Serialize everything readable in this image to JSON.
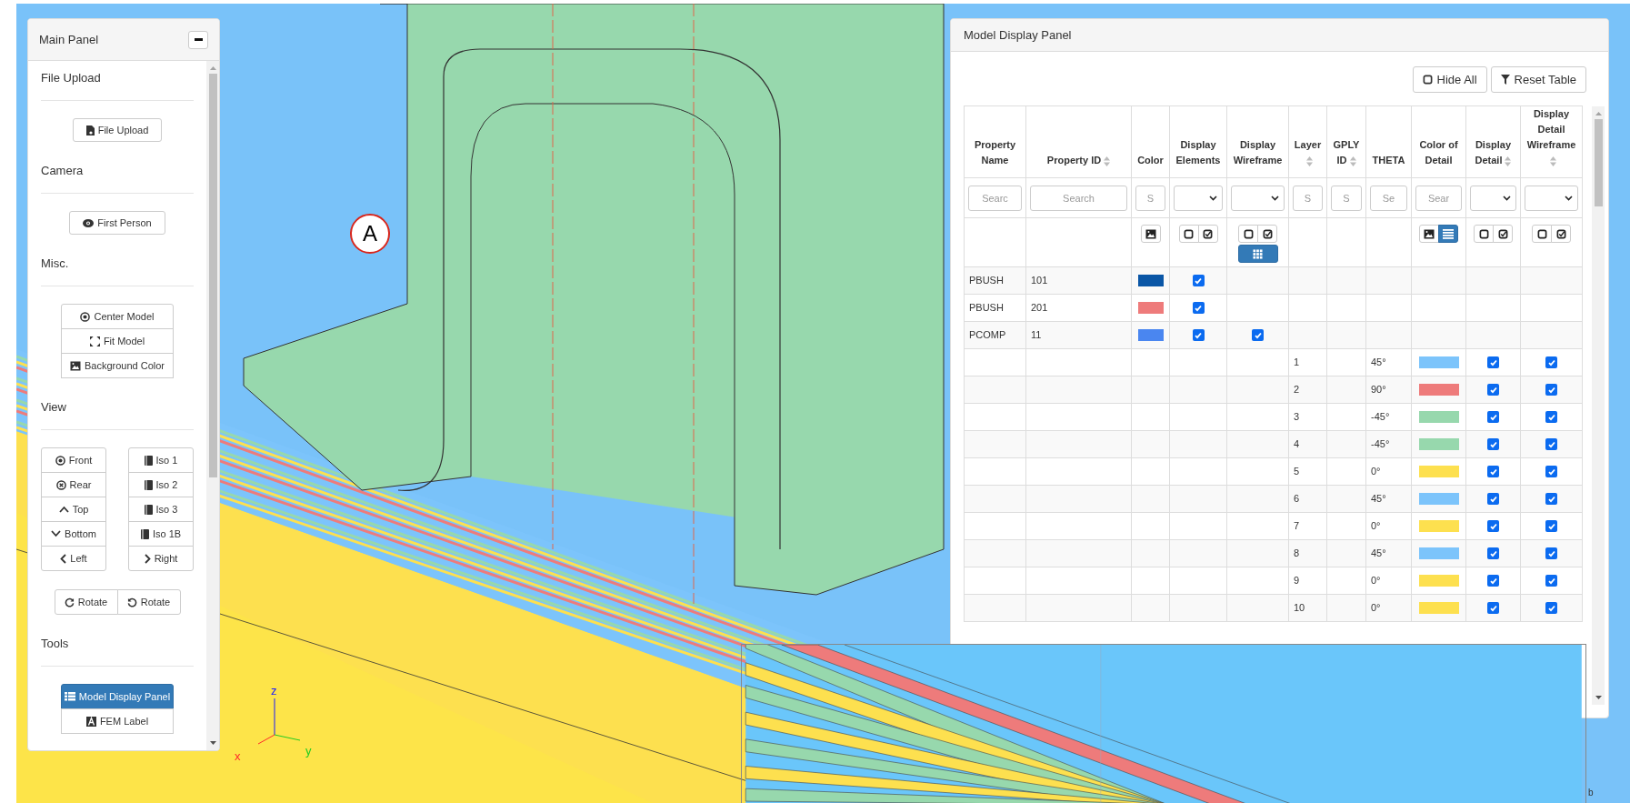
{
  "main_panel": {
    "title": "Main Panel",
    "sections": [
      {
        "title": "File Upload",
        "groups": [
          {
            "kind": "single",
            "buttons": [
              {
                "label": "File Upload"
              }
            ]
          }
        ]
      },
      {
        "title": "Camera",
        "groups": [
          {
            "kind": "single",
            "buttons": [
              {
                "label": "First Person"
              }
            ]
          }
        ]
      },
      {
        "title": "Misc.",
        "groups": [
          {
            "kind": "stack",
            "buttons": [
              {
                "label": "Center Model"
              },
              {
                "label": "Fit Model"
              },
              {
                "label": "Background Color"
              }
            ]
          }
        ]
      },
      {
        "title": "View",
        "groups": [
          {
            "kind": "columns",
            "columns": [
              [
                {
                  "label": "Front"
                },
                {
                  "label": "Rear"
                },
                {
                  "label": "Top"
                },
                {
                  "label": "Bottom"
                },
                {
                  "label": "Left"
                }
              ],
              [
                {
                  "label": "Iso 1"
                },
                {
                  "label": "Iso 2"
                },
                {
                  "label": "Iso 3"
                },
                {
                  "label": "Iso 1B"
                },
                {
                  "label": "Right"
                }
              ]
            ]
          },
          {
            "kind": "row",
            "buttons": [
              {
                "label": "Rotate"
              },
              {
                "label": "Rotate"
              }
            ]
          }
        ]
      },
      {
        "title": "Tools",
        "groups": [
          {
            "kind": "stack",
            "buttons": [
              {
                "label": "Model Display Panel",
                "selected": true
              },
              {
                "label": "FEM Label",
                "selected": false
              }
            ]
          }
        ]
      }
    ]
  },
  "model_display_panel": {
    "title": "Model Display Panel",
    "buttons": [
      "Hide All",
      "Reset Table"
    ],
    "columns": [
      {
        "label": "Property Name",
        "sortable": false,
        "filter": {
          "kind": "text",
          "placeholder": "Searc"
        }
      },
      {
        "label": "Property ID",
        "sortable": true,
        "filter": {
          "kind": "text",
          "placeholder": "Search"
        }
      },
      {
        "label": "Color",
        "sortable": false,
        "filter": {
          "kind": "text",
          "placeholder": "S"
        },
        "tools": [
          {
            "kind": "image",
            "selected": false
          }
        ]
      },
      {
        "label": "Display Elements",
        "sortable": false,
        "filter": {
          "kind": "select"
        },
        "tools": [
          {
            "kind": "uncheck-all",
            "selected": false
          },
          {
            "kind": "check-all",
            "selected": false
          }
        ]
      },
      {
        "label": "Display Wireframe",
        "sortable": false,
        "filter": {
          "kind": "select"
        },
        "tools": [
          {
            "kind": "uncheck-all",
            "selected": false
          },
          {
            "kind": "check-all",
            "selected": false
          },
          {
            "kind": "grid",
            "selected": true
          }
        ]
      },
      {
        "label": "Layer",
        "sortable": true,
        "filter": {
          "kind": "text",
          "placeholder": "S"
        }
      },
      {
        "label": "GPLY ID",
        "sortable": true,
        "filter": {
          "kind": "text",
          "placeholder": "S"
        }
      },
      {
        "label": "THETA",
        "sortable": false,
        "filter": {
          "kind": "text",
          "placeholder": "Se"
        }
      },
      {
        "label": "Color of Detail",
        "sortable": false,
        "filter": {
          "kind": "text",
          "placeholder": "Sear"
        },
        "tools": [
          {
            "kind": "image",
            "selected": false
          },
          {
            "kind": "list",
            "selected": true
          }
        ]
      },
      {
        "label": "Display Detail",
        "sortable": true,
        "filter": {
          "kind": "select"
        },
        "tools": [
          {
            "kind": "uncheck-all",
            "selected": false
          },
          {
            "kind": "check-all",
            "selected": false
          }
        ]
      },
      {
        "label": "Display Detail Wireframe",
        "sortable": true,
        "filter": {
          "kind": "select"
        },
        "tools": [
          {
            "kind": "uncheck-all",
            "selected": false
          },
          {
            "kind": "check-all",
            "selected": false
          }
        ]
      }
    ],
    "rows": [
      {
        "kind": "property",
        "name": "PBUSH",
        "id": "101",
        "color": "#0a56a6",
        "display_elements": true
      },
      {
        "kind": "property",
        "name": "PBUSH",
        "id": "201",
        "color": "#ee7b7b",
        "display_elements": true
      },
      {
        "kind": "property",
        "name": "PCOMP",
        "id": "11",
        "color": "#4a86f0",
        "display_elements": true,
        "display_wireframe": true
      },
      {
        "kind": "layer",
        "layer": "1",
        "theta": "45°",
        "color": "#7cc4fb",
        "display_detail": true,
        "display_detail_wireframe": true
      },
      {
        "kind": "layer",
        "layer": "2",
        "theta": "90°",
        "color": "#ee7b7b",
        "display_detail": true,
        "display_detail_wireframe": true
      },
      {
        "kind": "layer",
        "layer": "3",
        "theta": "-45°",
        "color": "#97d8ad",
        "display_detail": true,
        "display_detail_wireframe": true
      },
      {
        "kind": "layer",
        "layer": "4",
        "theta": "-45°",
        "color": "#97d8ad",
        "display_detail": true,
        "display_detail_wireframe": true
      },
      {
        "kind": "layer",
        "layer": "5",
        "theta": "0°",
        "color": "#fde04f",
        "display_detail": true,
        "display_detail_wireframe": true
      },
      {
        "kind": "layer",
        "layer": "6",
        "theta": "45°",
        "color": "#7cc4fb",
        "display_detail": true,
        "display_detail_wireframe": true
      },
      {
        "kind": "layer",
        "layer": "7",
        "theta": "0°",
        "color": "#fde04f",
        "display_detail": true,
        "display_detail_wireframe": true
      },
      {
        "kind": "layer",
        "layer": "8",
        "theta": "45°",
        "color": "#7cc4fb",
        "display_detail": true,
        "display_detail_wireframe": true
      },
      {
        "kind": "layer",
        "layer": "9",
        "theta": "0°",
        "color": "#fde04f",
        "display_detail": true,
        "display_detail_wireframe": true
      },
      {
        "kind": "layer",
        "layer": "10",
        "theta": "0°",
        "color": "#fde04f",
        "display_detail": true,
        "display_detail_wireframe": true
      }
    ]
  },
  "viewport": {
    "callout": "A",
    "axes": {
      "x": "x",
      "y": "y",
      "z": "z"
    },
    "corner_text": "b"
  }
}
